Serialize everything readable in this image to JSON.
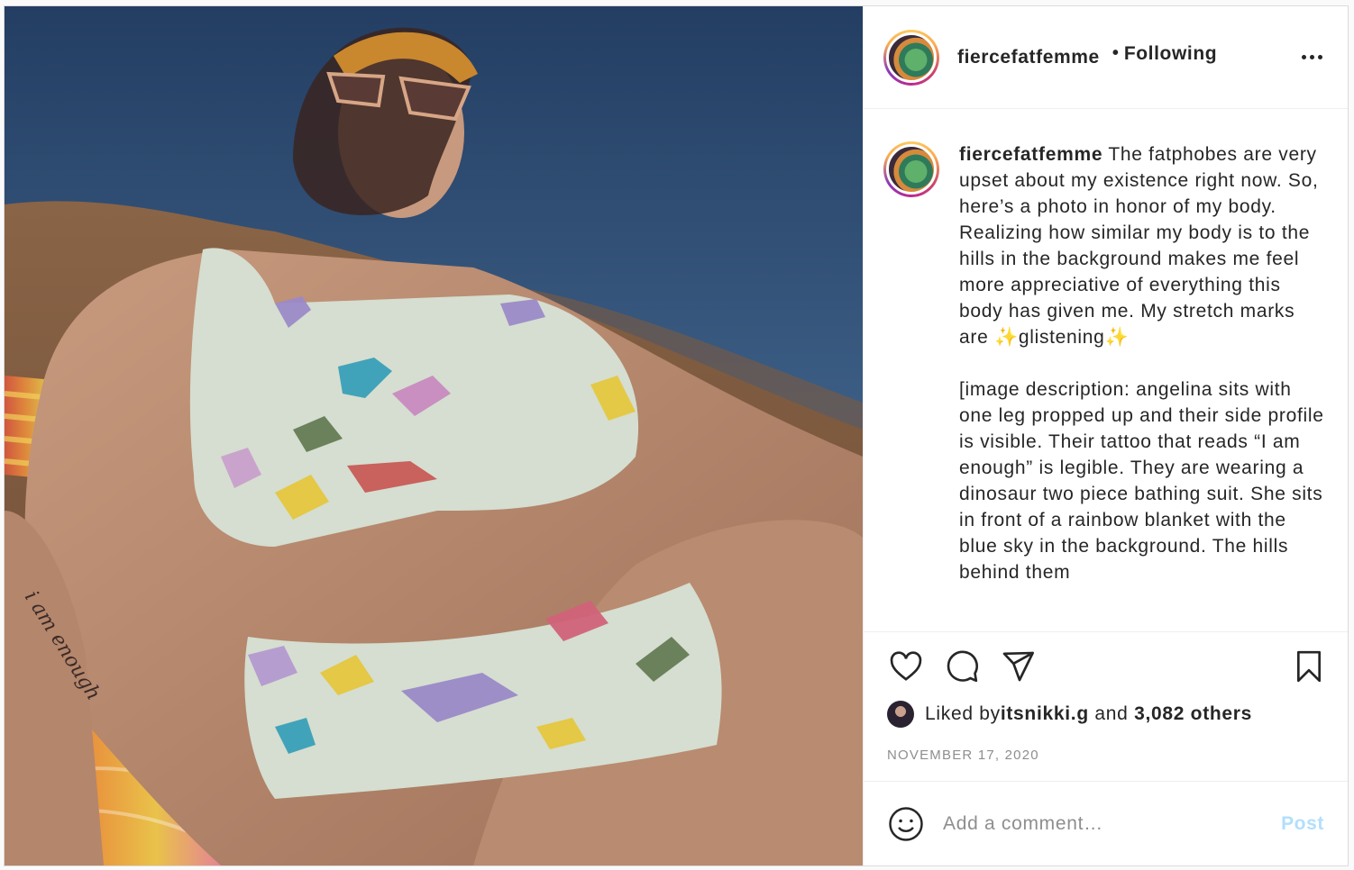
{
  "post": {
    "username": "fiercefatfemme",
    "separator": "•",
    "follow_status": "Following",
    "caption": " The fatphobes are very upset about my existence right now. So, here’s a photo in honor of my body. Realizing how similar my body is to the hills in the background makes me feel more appreciative of everything this body has given me. My stretch marks are ✨glistening✨\n\n[image description: angelina sits with one leg propped up and their side profile is visible. Their tattoo that reads “I am enough” is legible. They are wearing a dinosaur two piece bathing suit. She sits in front of a rainbow blanket with the blue sky in the background. The hills behind them",
    "photo_tattoo": "i am enough"
  },
  "actions": {
    "like_icon": "heart-icon",
    "comment_icon": "comment-bubble-icon",
    "share_icon": "paper-plane-icon",
    "save_icon": "bookmark-icon"
  },
  "likes": {
    "prefix": "Liked by ",
    "user": "itsnikki.g",
    "middle": " and ",
    "count": "3,082 others"
  },
  "date": "NOVEMBER 17, 2020",
  "comment_box": {
    "placeholder": "Add a comment…",
    "post_label": "Post",
    "emoji_icon": "smiley-icon"
  },
  "colors": {
    "post_button_disabled": "#b2dffc",
    "muted_text": "#8e8e8e",
    "border": "#dbdbdb"
  }
}
